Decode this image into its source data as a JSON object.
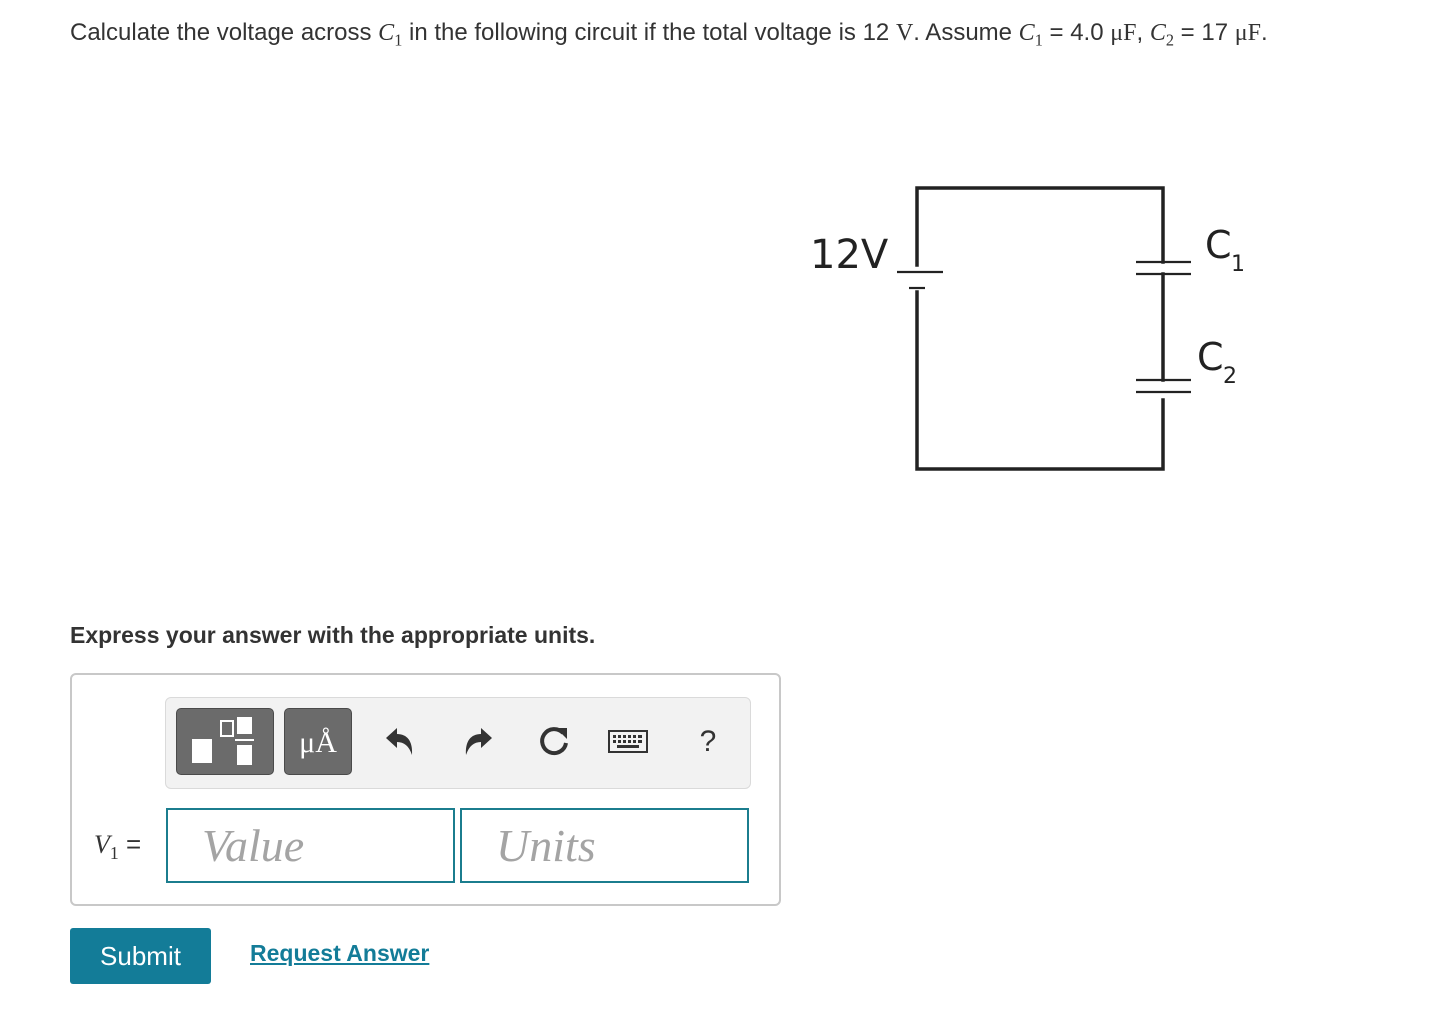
{
  "question": {
    "p1": "Calculate the voltage across ",
    "c1_sym": "C",
    "c1_sub": "1",
    "p2": " in the following circuit if the total voltage is ",
    "total_v_value": "12",
    "total_v_unit": "V",
    "p3": ". Assume ",
    "c1_sym_b": "C",
    "c1_sub_b": "1",
    "eq1": " = ",
    "c1_value": "4.0",
    "c1_unit": "μF",
    "sep": ", ",
    "c2_sym": "C",
    "c2_sub": "2",
    "eq2": " = ",
    "c2_value": "17",
    "c2_unit": "μF",
    "end": "."
  },
  "circuit": {
    "source_label": "12V",
    "cap1_label": "C",
    "cap1_sub": "1",
    "cap2_label": "C",
    "cap2_sub": "2"
  },
  "instruction": "Express your answer with the appropriate units.",
  "toolbar": {
    "units_label": "μÅ",
    "help_label": "?",
    "icons": [
      "templates-icon",
      "units-icon",
      "undo-icon",
      "redo-icon",
      "reset-icon",
      "keyboard-icon",
      "help-icon"
    ]
  },
  "answer": {
    "var_sym": "V",
    "var_sub": "1",
    "equals": " =",
    "value_placeholder": "Value",
    "units_placeholder": "Units"
  },
  "actions": {
    "submit_label": "Submit",
    "request_answer_label": "Request Answer"
  },
  "colors": {
    "accent": "#137c98",
    "input_border": "#1b7d8e",
    "toolbar_button": "#6b6b6b",
    "text": "#333333"
  }
}
